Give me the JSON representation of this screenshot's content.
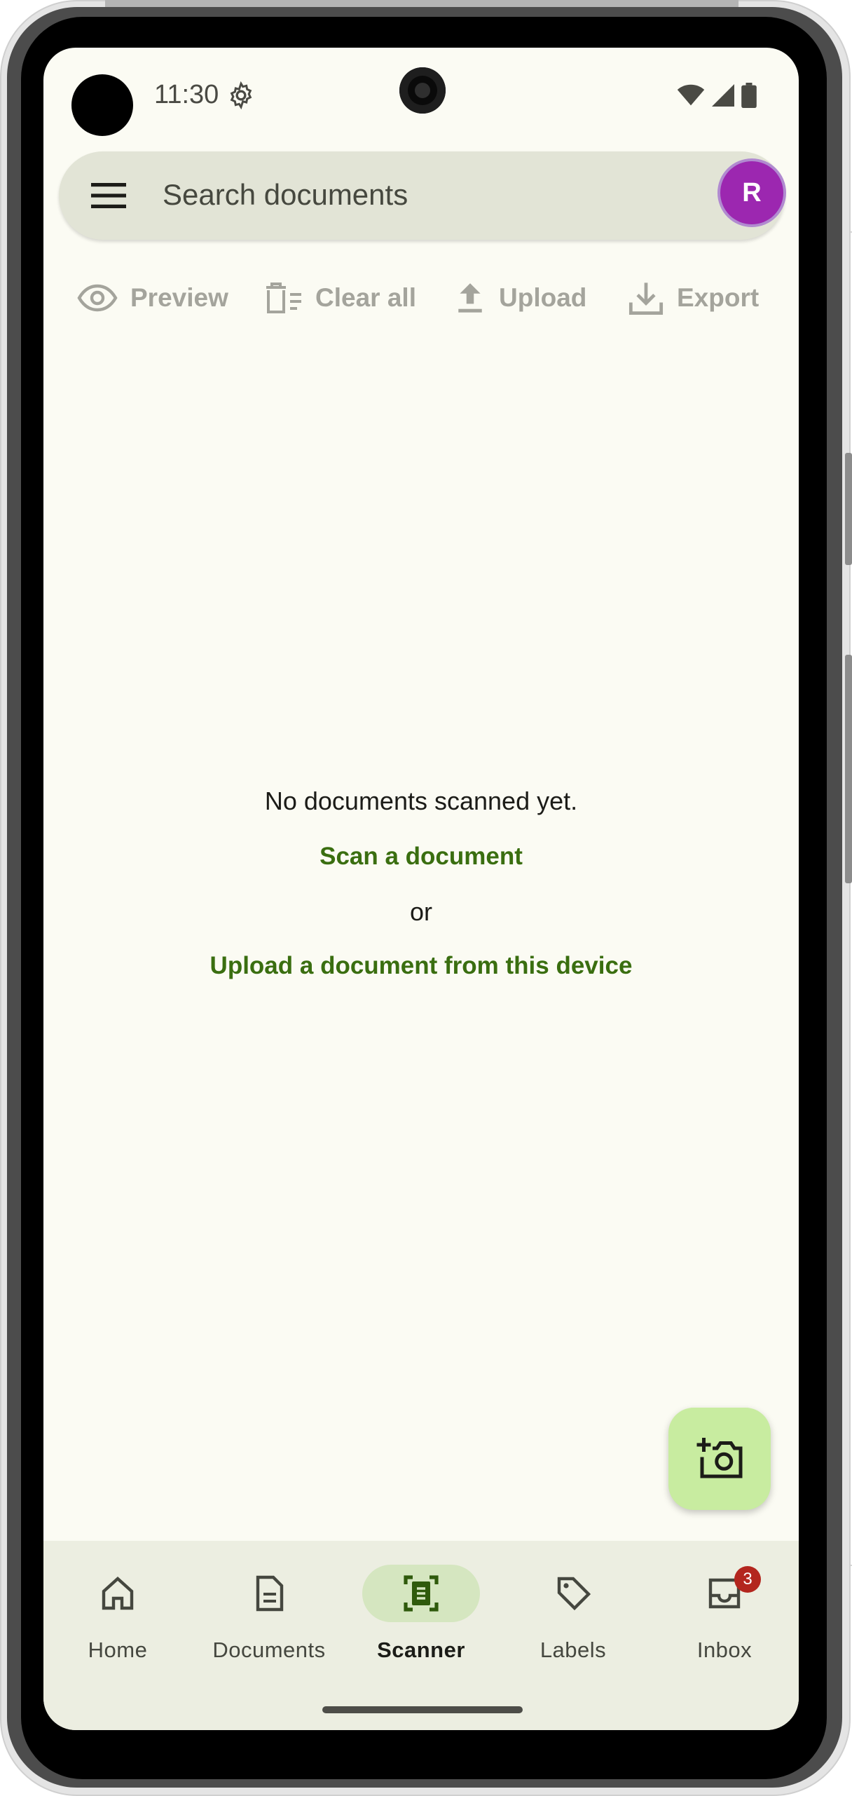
{
  "status_bar": {
    "time": "11:30"
  },
  "search": {
    "placeholder": "Search documents",
    "avatar_initial": "R"
  },
  "toolbar": {
    "preview_label": "Preview",
    "clear_all_label": "Clear all",
    "upload_label": "Upload",
    "export_label": "Export"
  },
  "empty_state": {
    "message": "No documents scanned yet.",
    "scan_link": "Scan a document",
    "or_text": "or",
    "upload_link": "Upload a document from this device"
  },
  "bottom_nav": {
    "items": [
      {
        "label": "Home",
        "icon": "home-icon"
      },
      {
        "label": "Documents",
        "icon": "document-icon"
      },
      {
        "label": "Scanner",
        "icon": "scanner-icon",
        "active": true
      },
      {
        "label": "Labels",
        "icon": "label-icon"
      },
      {
        "label": "Inbox",
        "icon": "inbox-icon",
        "badge": "3"
      }
    ]
  },
  "colors": {
    "accent_green": "#3a6e10",
    "fab_background": "#c8eca0",
    "avatar": "#9c27b0",
    "badge": "#b3261e"
  }
}
